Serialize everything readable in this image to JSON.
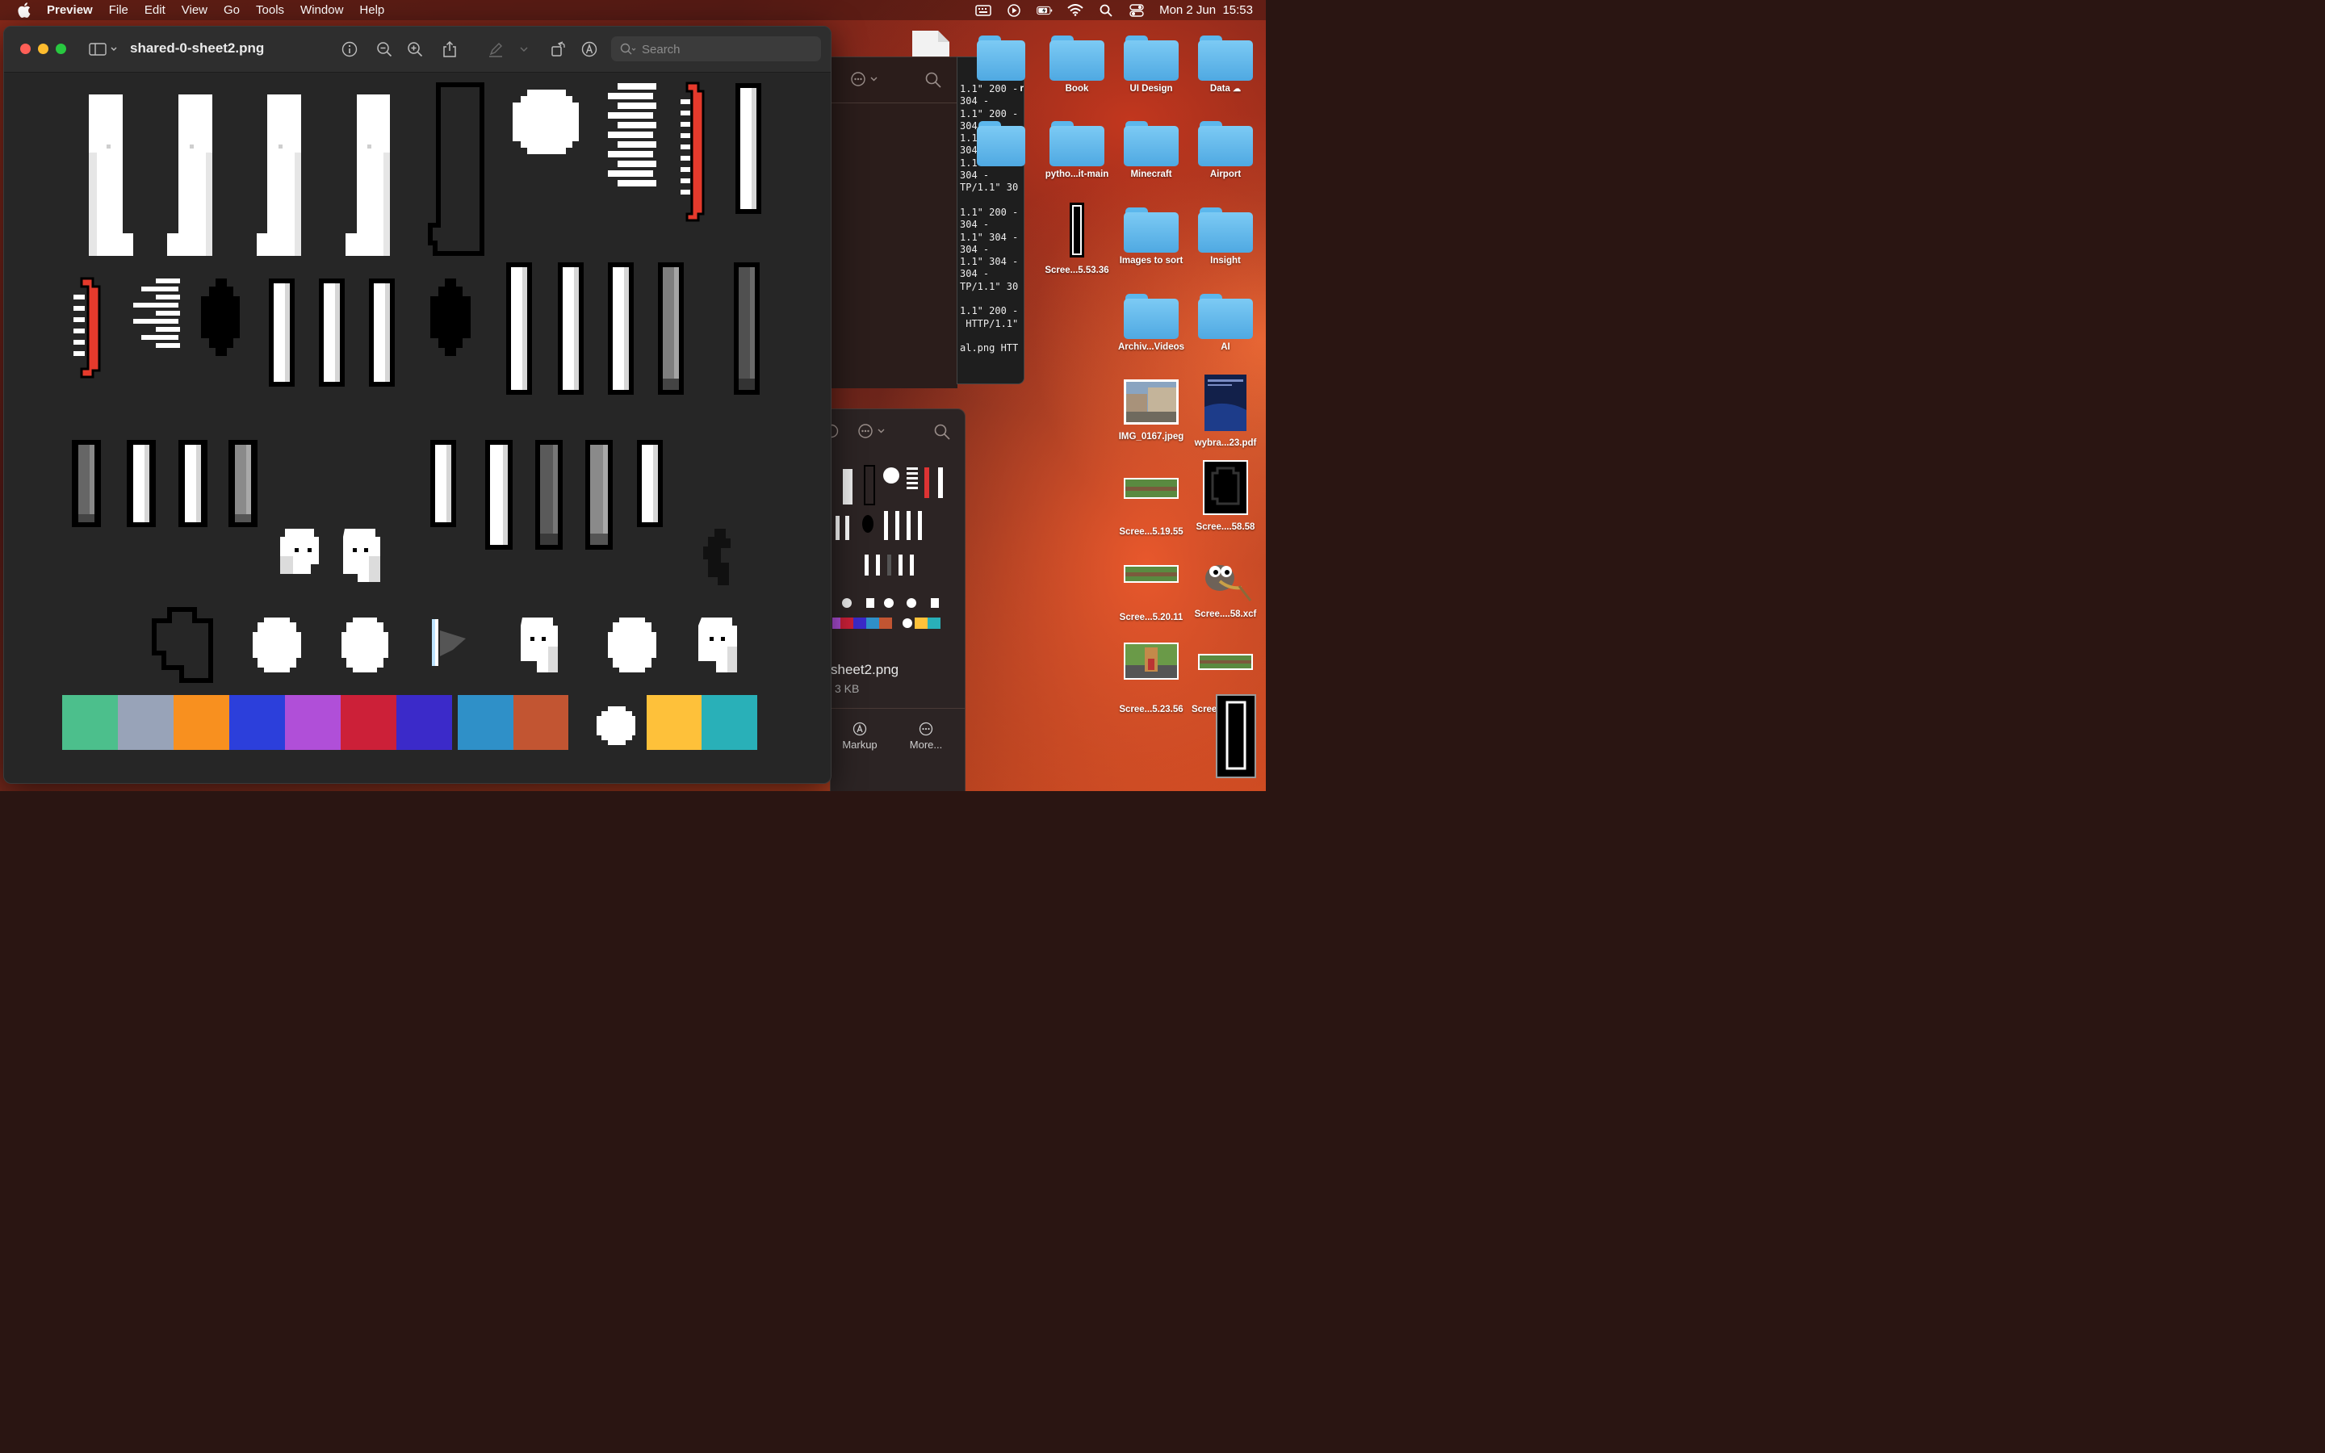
{
  "menubar": {
    "app_name": "Preview",
    "menus": [
      "File",
      "Edit",
      "View",
      "Go",
      "Tools",
      "Window",
      "Help"
    ],
    "clock": "Mon 2 Jun  15:53"
  },
  "preview": {
    "title": "shared-0-sheet2.png",
    "search_placeholder": "Search",
    "palette": [
      "#4cbf8c",
      "#98a3b8",
      "#f8901f",
      "#2c3fdb",
      "#b04fd8",
      "#cc2038",
      "#3b2ac9",
      "#2f90c8",
      "#c25532",
      "#ffffff",
      "#fec13a",
      "#29b0b8"
    ]
  },
  "terminal": {
    "lines": [
      "1.1\" 200 -",
      "304 -",
      "1.1\" 200 -",
      "304 -",
      "1.1\" 200 -",
      "304 -",
      "1.1\" 200 -",
      "304 -",
      "TP/1.1\" 30",
      "",
      "1.1\" 200 -",
      "304 -",
      "1.1\" 304 -",
      "304 -",
      "1.1\" 304 -",
      "304 -",
      "TP/1.1\" 30",
      "",
      "1.1\" 200 -",
      " HTTP/1.1\"",
      "",
      "al.png HTT"
    ]
  },
  "finder_preview": {
    "file_name": "sheet2.png",
    "file_size": "3 KB",
    "markup_label": "Markup",
    "more_label": "More..."
  },
  "desktop": {
    "partial_label": "r",
    "items": [
      {
        "label": "Book",
        "kind": "folder"
      },
      {
        "label": "UI Design",
        "kind": "folder"
      },
      {
        "label": "Data",
        "kind": "folder"
      },
      {
        "label": "pytho...it-main",
        "kind": "folder"
      },
      {
        "label": "Minecraft",
        "kind": "folder"
      },
      {
        "label": "Airport",
        "kind": "folder"
      },
      {
        "label": "Scree...5.53.36",
        "kind": "image"
      },
      {
        "label": "Images to sort",
        "kind": "folder"
      },
      {
        "label": "Insight",
        "kind": "folder"
      },
      {
        "label": "Archiv...Videos",
        "kind": "folder"
      },
      {
        "label": "AI",
        "kind": "folder"
      },
      {
        "label": "IMG_0167.jpeg",
        "kind": "image"
      },
      {
        "label": "wybra...23.pdf",
        "kind": "pdf"
      },
      {
        "label": "Scree...5.19.55",
        "kind": "image"
      },
      {
        "label": "Scree....58.58",
        "kind": "image"
      },
      {
        "label": "Scree...5.20.11",
        "kind": "image"
      },
      {
        "label": "Scree....58.xcf",
        "kind": "xcf"
      },
      {
        "label": "Scree...5.23.56",
        "kind": "image"
      },
      {
        "label": "Scree",
        "kind": "image"
      }
    ]
  }
}
